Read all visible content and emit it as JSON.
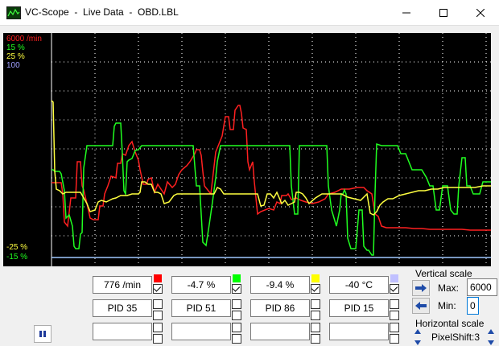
{
  "window": {
    "title": "VC-Scope  -  Live Data  -  OBD.LBL"
  },
  "scope": {
    "scale_labels": [
      {
        "text": "6000 /min",
        "color": "#ff2020"
      },
      {
        "text": "15 %",
        "color": "#20ff20"
      },
      {
        "text": "25 %",
        "color": "#ffff40"
      },
      {
        "text": "100",
        "color": "#a0a0ff"
      }
    ],
    "bottom_labels": [
      {
        "text": "-25 %",
        "color": "#ffff40"
      },
      {
        "text": "-15 %",
        "color": "#20ff20"
      }
    ],
    "grid": true,
    "colors": {
      "background": "#000000",
      "grid": "#ffffff",
      "red": "#ff2020",
      "green": "#20ff20",
      "yellow": "#ffff40",
      "blue": "#a0c8ff"
    }
  },
  "channels": [
    {
      "value": "776 /min",
      "pid": "PID 35",
      "color": "#ff0000",
      "checked": true
    },
    {
      "value": "-4.7 %",
      "pid": "PID 51",
      "color": "#00ff00",
      "checked": true
    },
    {
      "value": "-9.4 %",
      "pid": "PID 86",
      "color": "#ffff00",
      "checked": true
    },
    {
      "value": "-40 °C",
      "pid": "PID 15",
      "color": "#c0c0ff",
      "checked": true
    }
  ],
  "vertical_scale": {
    "heading": "Vertical scale",
    "max_label": "Max:",
    "max_value": "6000",
    "min_label": "Min:",
    "min_value": "0"
  },
  "horizontal_scale": {
    "heading": "Horizontal scale",
    "pixelshift_label": "PixelShift:3"
  }
}
